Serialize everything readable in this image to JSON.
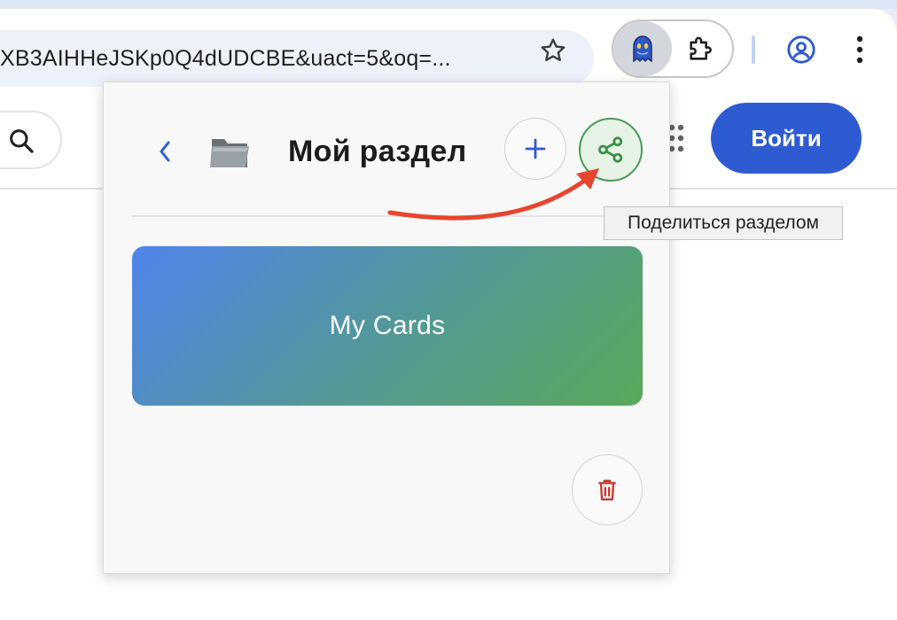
{
  "browser": {
    "url_display": "XB3AIHHeJSKp0Q4dUDCBE&uact=5&oq=...",
    "icons": [
      "star-icon",
      "extension-ghost-icon",
      "puzzle-icon",
      "profile-icon",
      "more-vert-icon"
    ]
  },
  "page": {
    "login_label": "Войти",
    "icons": [
      "search-icon",
      "apps-dots-icon"
    ],
    "colors": {
      "login_bg": "#2f5bd2"
    }
  },
  "popup": {
    "title": "Мой раздел",
    "icons": [
      "chevron-left-icon",
      "folder-icon",
      "plus-icon",
      "share-icon",
      "trash-icon"
    ],
    "card": {
      "title": "My Cards"
    },
    "colors": {
      "share_accent": "#4a9a57",
      "delete_accent": "#c43d2f",
      "card_gradient_start": "#4f84ec",
      "card_gradient_end": "#58a95a"
    }
  },
  "annotation": {
    "tooltip": "Поделиться разделом",
    "arrow_color": "#e8452e"
  }
}
